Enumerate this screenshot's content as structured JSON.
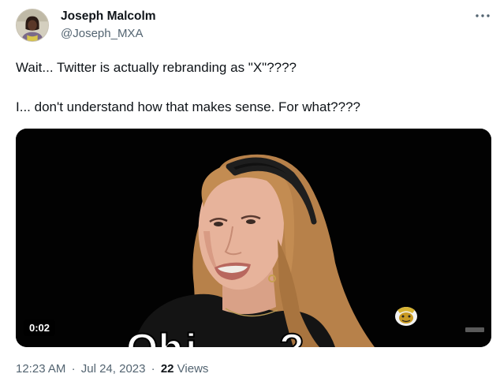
{
  "author": {
    "name": "Joseph Malcolm",
    "handle": "@Joseph_MXA",
    "avatar_icon": "profile-photo"
  },
  "more_icon": "more-horizontal-icon",
  "tweet": {
    "lines": [
      "Wait... Twitter is actually rebranding as \"X\"????",
      "I... don't understand how that makes sense. For what????"
    ]
  },
  "media": {
    "type": "video",
    "duration": "0:02",
    "channel_logo_icon": "hot-ones-logo-icon"
  },
  "meta": {
    "time": "12:23 AM",
    "date": "Jul 24, 2023",
    "views_count": "22",
    "views_label": "Views",
    "separator": "·"
  },
  "colors": {
    "text": "#0f1419",
    "secondary": "#536471",
    "media_bg": "#020202",
    "hair": "#c9945a",
    "skin": "#e8b49c"
  }
}
